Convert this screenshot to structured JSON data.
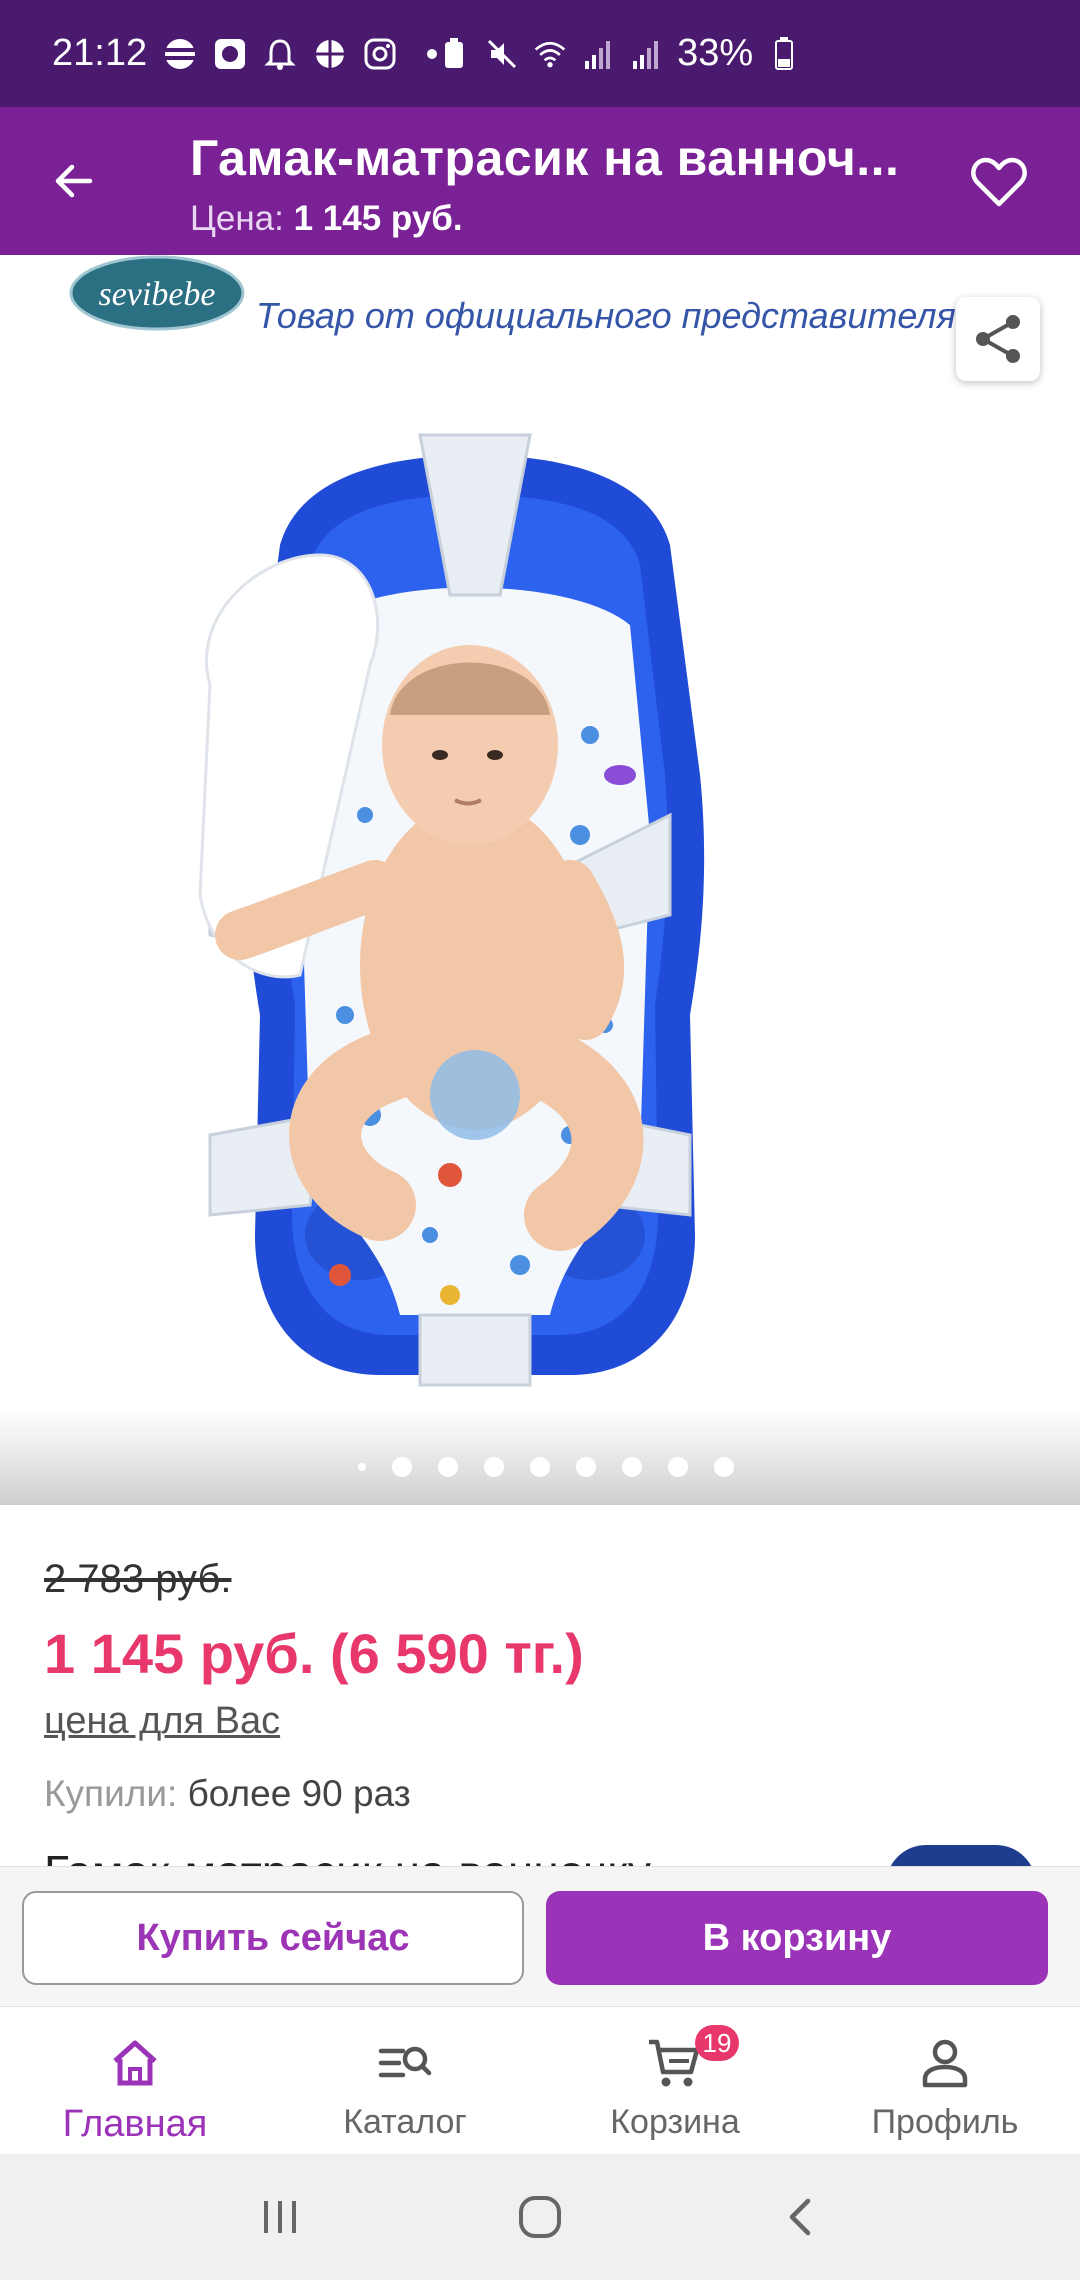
{
  "status_bar": {
    "time": "21:12",
    "battery": "33%"
  },
  "app_bar": {
    "title": "Гамак-матрасик на ванноч...",
    "subtitle_label": "Цена:",
    "subtitle_value": "1 145 руб."
  },
  "gallery": {
    "brand_logo_text": "sevibebe",
    "banner_text": "Товар от официального представителя в",
    "image_count": 8,
    "active_index": 0
  },
  "price": {
    "old": "2 783 руб.",
    "current": "1 145 руб.  (6 590 тг.)",
    "note": "цена для Вас",
    "bought_label": "Купили:",
    "bought_value": "более 90 раз",
    "product_title_peek": "Гамак-матрасик на ванночку"
  },
  "actions": {
    "buy_now": "Купить сейчас",
    "to_cart": "В корзину"
  },
  "nav": {
    "home": "Главная",
    "catalog": "Каталог",
    "cart": "Корзина",
    "cart_badge": "19",
    "profile": "Профиль"
  },
  "colors": {
    "status_bar": "#4a1a6e",
    "app_bar": "#7b2196",
    "accent": "#9b33b8",
    "price": "#e8376b"
  }
}
